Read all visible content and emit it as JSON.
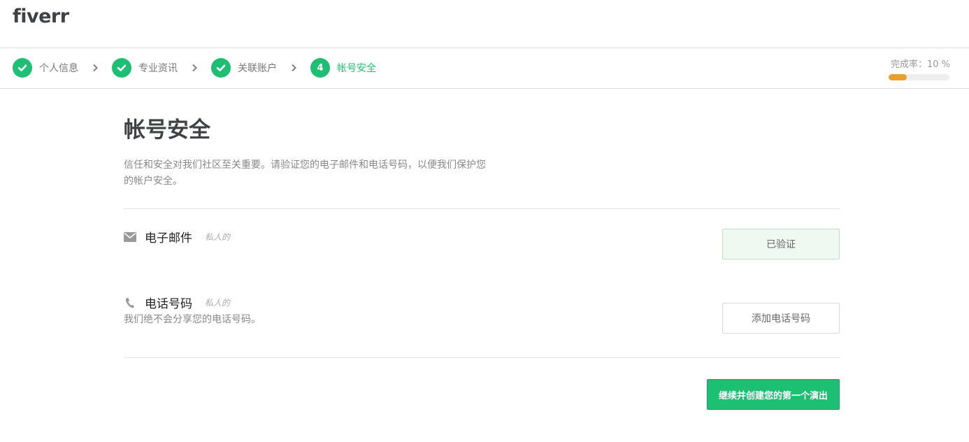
{
  "header": {
    "logo": "fiverr"
  },
  "steps": [
    {
      "number": "",
      "label": "个人信息",
      "state": "done"
    },
    {
      "number": "",
      "label": "专业资讯",
      "state": "done"
    },
    {
      "number": "",
      "label": "关联账户",
      "state": "done"
    },
    {
      "number": "4",
      "label": "帐号安全",
      "state": "active"
    }
  ],
  "progress": {
    "label": "完成率：10 %",
    "value": 0.1,
    "color": "#e8a02b"
  },
  "page": {
    "title": "帐号安全",
    "description": "信任和安全对我们社区至关重要。请验证您的电子邮件和电话号码，以便我们保护您的帐户安全。"
  },
  "email": {
    "icon": "envelope-icon",
    "label": "电子邮件",
    "private": "私人的",
    "button": "已验证"
  },
  "phone": {
    "icon": "phone-icon",
    "label": "电话号码",
    "private": "私人的",
    "note": "我们绝不会分享您的电话号码。",
    "button": "添加电话号码"
  },
  "footer": {
    "continue_button": "继续并创建您的第一个演出"
  },
  "colors": {
    "brand": "#1dbf73",
    "progress": "#e8a02b"
  }
}
